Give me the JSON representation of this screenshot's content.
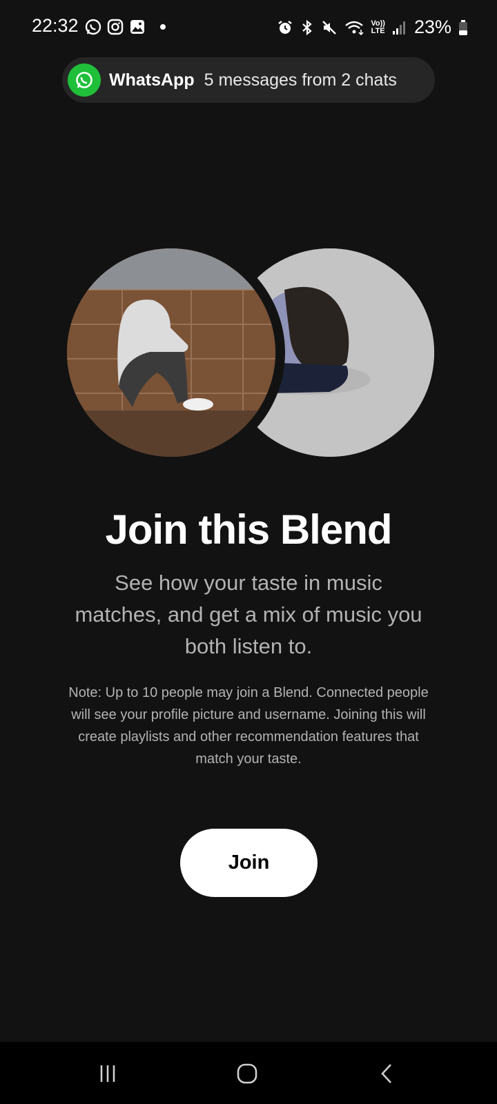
{
  "status_bar": {
    "time": "22:32",
    "battery": "23%",
    "network_label_top": "Vo))",
    "network_label_bottom": "LTE",
    "left_icons": [
      "whatsapp-icon",
      "instagram-icon",
      "gallery-icon",
      "dot"
    ],
    "right_icons": [
      "alarm-icon",
      "bluetooth-icon",
      "mute-icon",
      "wifi-icon",
      "signal-icon",
      "battery-icon"
    ]
  },
  "notification": {
    "app": "WhatsApp",
    "text": "5 messages from 2 chats",
    "icon": "whatsapp-icon",
    "accent": "#1fbf3a"
  },
  "blend": {
    "title": "Join this Blend",
    "subtitle": "See how your taste in music matches, and get a mix of music you both listen to.",
    "note": "Note: Up to 10 people may join a Blend. Connected people will see your profile picture and username. Joining this will create playlists and other recommendation features that match your taste.",
    "join_label": "Join"
  },
  "nav": {
    "icons": [
      "recents-icon",
      "home-icon",
      "back-icon"
    ]
  },
  "colors": {
    "background": "#121212",
    "button_bg": "#ffffff",
    "secondary_text": "#b3b3b3"
  }
}
